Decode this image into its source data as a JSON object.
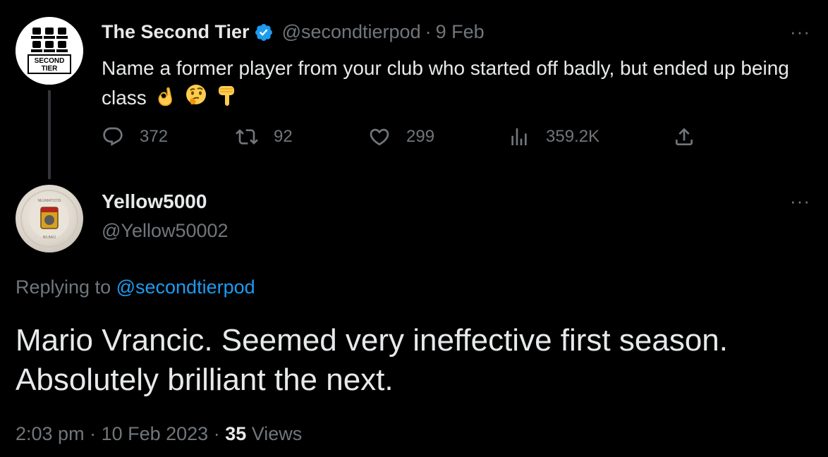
{
  "original_tweet": {
    "display_name": "The Second Tier",
    "handle": "@secondtierpod",
    "separator": "·",
    "date": "9 Feb",
    "text": "Name a former player from your club who started off badly, but ended up being class",
    "avatar_text": [
      "SECOND",
      "TIER"
    ],
    "more": "···",
    "stats": {
      "replies": "372",
      "retweets": "92",
      "likes": "299",
      "views": "359.2K"
    }
  },
  "reply_tweet": {
    "display_name": "Yellow5000",
    "handle": "@Yellow50002",
    "more": "···",
    "replying_prefix": "Replying to ",
    "replying_handle": "@secondtierpod",
    "text": "Mario Vrancic. Seemed very ineffective first season. Absolutely brilliant the next.",
    "time": "2:03 pm",
    "meta_sep1": " · ",
    "date": "10 Feb 2023",
    "meta_sep2": " · ",
    "views_count": "35",
    "views_label": " Views",
    "avatar_text": [
      "NEUMATICOS",
      "BILBAO"
    ]
  },
  "colors": {
    "background": "#000000",
    "text": "#e7e9ea",
    "muted": "#71767b",
    "link": "#1d9bf0",
    "verified": "#1d9bf0"
  }
}
